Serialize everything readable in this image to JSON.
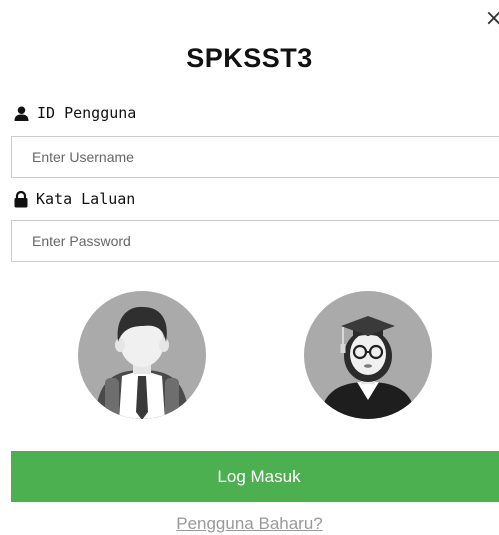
{
  "modal": {
    "close_symbol": "×",
    "title": "SPKSST3"
  },
  "username": {
    "icon": "user-icon",
    "label": "ID Pengguna",
    "placeholder": "Enter Username",
    "value": ""
  },
  "password": {
    "icon": "lock-icon",
    "label": "Kata Laluan",
    "placeholder": "Enter Password",
    "value": ""
  },
  "avatars": [
    {
      "icon": "student-boy-avatar-icon"
    },
    {
      "icon": "graduate-woman-avatar-icon"
    }
  ],
  "actions": {
    "login_label": "Log Masuk",
    "register_label": "Pengguna Baharu?"
  },
  "colors": {
    "login_button": "#4caf50",
    "login_text": "#ffffff",
    "register_link": "#999999",
    "avatar_bg": "#aaaaaa"
  }
}
